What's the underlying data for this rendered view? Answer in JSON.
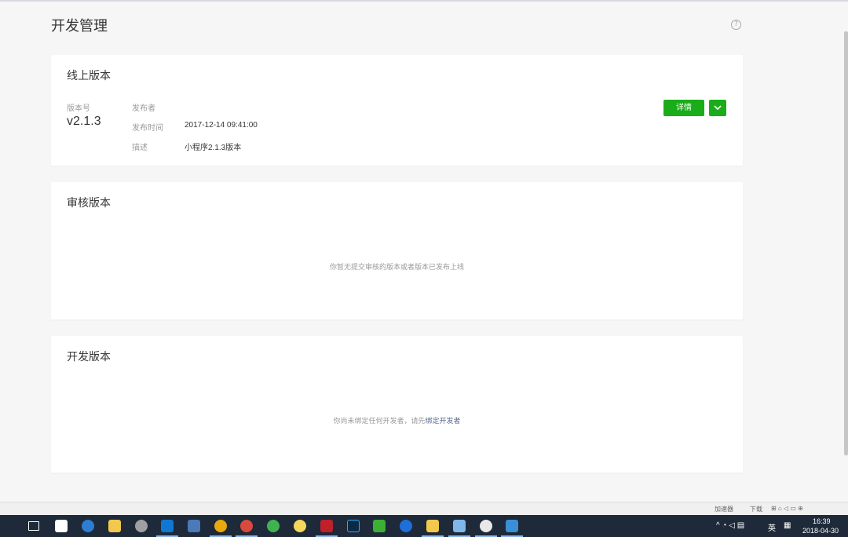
{
  "page": {
    "title": "开发管理"
  },
  "online": {
    "title": "线上版本",
    "version_label": "版本号",
    "version": "v2.1.3",
    "publisher_label": "发布者",
    "publisher": "",
    "time_label": "发布时间",
    "time": "2017-12-14 09:41:00",
    "desc_label": "描述",
    "desc": "小程序2.1.3版本",
    "detail_button": "详情"
  },
  "review": {
    "title": "审核版本",
    "empty_text": "你暂无提交审核的版本或者版本已发布上线"
  },
  "dev": {
    "title": "开发版本",
    "empty_text": "你尚未绑定任何开发者，请先",
    "empty_link": "绑定开发者"
  },
  "tray": {
    "accelerator": "加速器",
    "download": "下载"
  },
  "taskbar": {
    "ime": "英",
    "time": "16:39",
    "date": "2018-04-30"
  },
  "icons": {
    "help": "question-circle-icon",
    "more": "chevron-down-icon"
  },
  "colors": {
    "primary": "#1aad19",
    "link": "#576b95",
    "background": "#f6f6f6",
    "taskbar": "#1e2a3a"
  }
}
